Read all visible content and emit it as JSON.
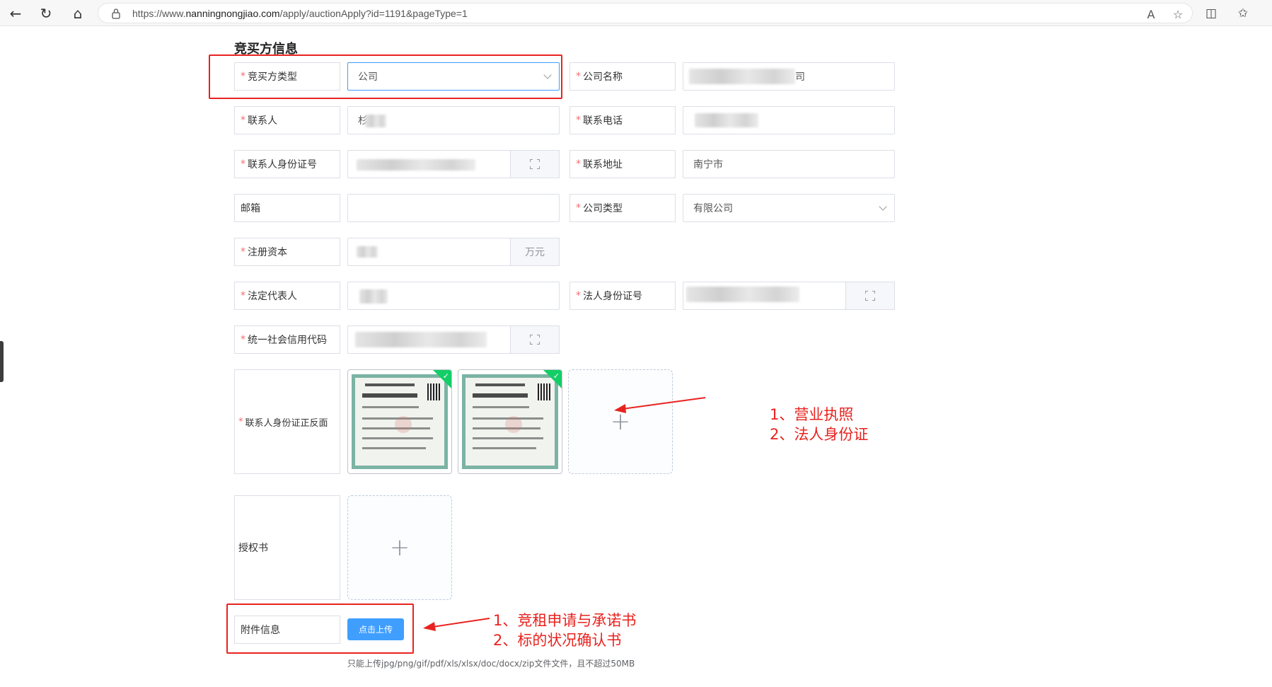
{
  "browser": {
    "url_prefix": "https://www.",
    "url_domain": "nanningnongjiao.com",
    "url_path": "/apply/auctionApply?id=1191&pageType=1"
  },
  "section_title": "竞买方信息",
  "fields": {
    "bidder_type": {
      "label": "竞买方类型",
      "value": "公司"
    },
    "company_name": {
      "label": "公司名称",
      "value": "司"
    },
    "contact_person": {
      "label": "联系人",
      "value": "杉"
    },
    "contact_phone": {
      "label": "联系电话",
      "value": ""
    },
    "contact_id": {
      "label": "联系人身份证号",
      "value": ""
    },
    "contact_address": {
      "label": "联系地址",
      "value": "南宁市"
    },
    "email": {
      "label": "邮箱",
      "value": ""
    },
    "company_type": {
      "label": "公司类型",
      "value": "有限公司"
    },
    "registered_capital": {
      "label": "注册资本",
      "value": "",
      "unit": "万元"
    },
    "legal_rep": {
      "label": "法定代表人",
      "value": ""
    },
    "legal_rep_id": {
      "label": "法人身份证号",
      "value": ""
    },
    "credit_code": {
      "label": "统一社会信用代码",
      "value": ""
    },
    "id_card_images": {
      "label": "联系人身份证正反面"
    },
    "authorization": {
      "label": "授权书"
    },
    "attachments": {
      "label": "附件信息",
      "button": "点击上传"
    }
  },
  "upload_hint": "只能上传jpg/png/gif/pdf/xls/xlsx/doc/docx/zip文件文件，且不超过50MB",
  "annotations": {
    "note1_line1": "1、营业执照",
    "note1_line2": "2、法人身份证",
    "note2_line1": "1、竞租申请与承诺书",
    "note2_line2": "2、标的状况确认书"
  },
  "colors": {
    "required": "#f56c6c",
    "primary": "#409eff",
    "annotation_red": "#e8231f",
    "success": "#13ce66"
  }
}
